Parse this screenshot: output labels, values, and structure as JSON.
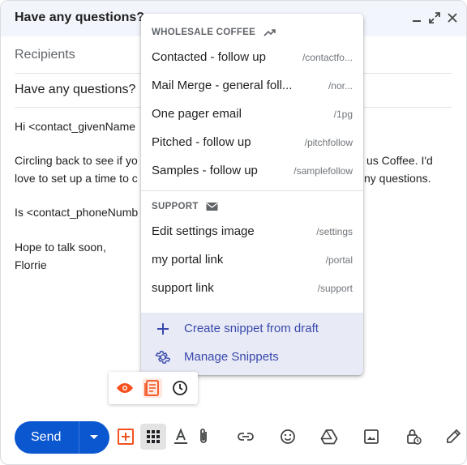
{
  "window": {
    "title": "Have any questions?",
    "minimize": "‒",
    "expand": "⤢",
    "close": "✕"
  },
  "compose": {
    "recipients_placeholder": "Recipients",
    "subject": "Have any questions?",
    "body": {
      "line1": "Hi <contact_givenName",
      "line2a": "Circling back to see if yo",
      "line2b": "us Coffee. I'd",
      "line3a": "love to set up a time to c",
      "line3b": "ny questions.",
      "line4a": "Is <contact_phoneNumb",
      "line4b": "",
      "line5": "Hope to talk soon,",
      "line6": "Florrie"
    }
  },
  "snippet_menu": {
    "sections": [
      {
        "header": "WHOLESALE COFFEE",
        "icon": "trending-icon",
        "items": [
          {
            "name": "Contacted - follow up",
            "shortcut": "/contactfo..."
          },
          {
            "name": "Mail Merge - general foll...",
            "shortcut": "/nor..."
          },
          {
            "name": "One pager email",
            "shortcut": "/1pg"
          },
          {
            "name": "Pitched - follow up",
            "shortcut": "/pitchfollow"
          },
          {
            "name": "Samples - follow up",
            "shortcut": "/samplefollow"
          }
        ]
      },
      {
        "header": "SUPPORT",
        "icon": "mail-icon",
        "items": [
          {
            "name": "Edit settings image",
            "shortcut": "/settings"
          },
          {
            "name": "my portal link",
            "shortcut": "/portal"
          },
          {
            "name": "support link",
            "shortcut": "/support"
          }
        ]
      }
    ],
    "footer": {
      "create_label": "Create snippet from draft",
      "manage_label": "Manage Snippets"
    }
  },
  "toolbar": {
    "send_label": "Send"
  },
  "colors": {
    "accent": "#0b57d0",
    "snippet_accent": "#3949ab",
    "extension_orange": "#f4511e"
  }
}
